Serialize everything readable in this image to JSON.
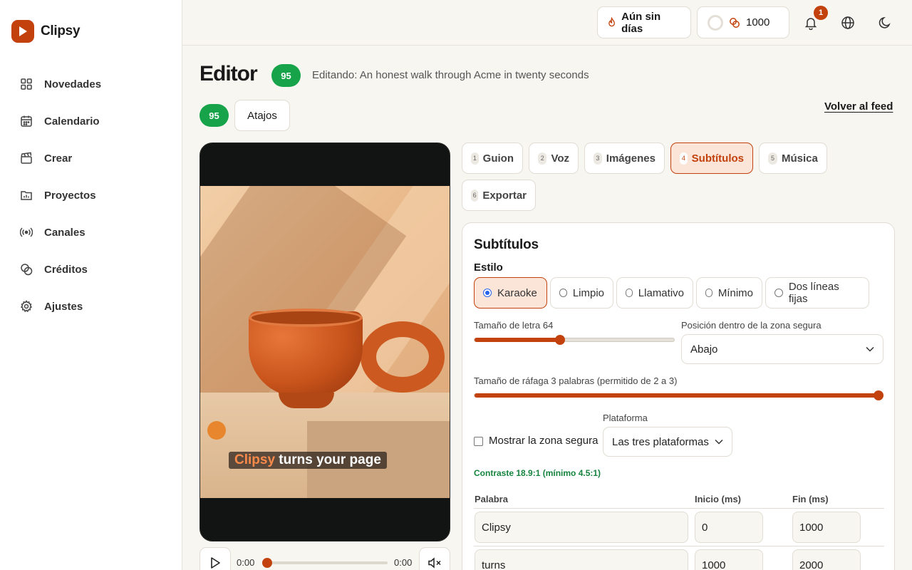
{
  "brand": {
    "name": "Clipsy"
  },
  "nav": [
    {
      "label": "Novedades"
    },
    {
      "label": "Calendario"
    },
    {
      "label": "Crear"
    },
    {
      "label": "Proyectos"
    },
    {
      "label": "Canales"
    },
    {
      "label": "Créditos"
    },
    {
      "label": "Ajustes"
    }
  ],
  "header": {
    "streak": "Aún sin días",
    "credits": "1000",
    "notifications_count": "1"
  },
  "page": {
    "title": "Editor",
    "score": "95",
    "editing": "Editando: An honest walk through Acme in twenty seconds",
    "score2": "95",
    "shortcuts": "Atajos",
    "back": "Volver al feed"
  },
  "video": {
    "caption_highlight": "Clipsy",
    "caption_rest": " turns your page",
    "time_current": "0:00",
    "time_total": "0:00",
    "progress": 0
  },
  "tabs": [
    {
      "num": "1",
      "label": "Guion"
    },
    {
      "num": "2",
      "label": "Voz"
    },
    {
      "num": "3",
      "label": "Imágenes"
    },
    {
      "num": "4",
      "label": "Subtítulos",
      "active": true
    },
    {
      "num": "5",
      "label": "Música"
    },
    {
      "num": "6",
      "label": "Exportar"
    }
  ],
  "panel": {
    "title": "Subtítulos",
    "style_label": "Estilo",
    "styles": [
      {
        "label": "Karaoke",
        "selected": true
      },
      {
        "label": "Limpio"
      },
      {
        "label": "Llamativo"
      },
      {
        "label": "Mínimo"
      },
      {
        "label": "Dos líneas fijas"
      }
    ],
    "font_size_label": "Tamaño de letra 64",
    "font_size_value": 64,
    "font_size_fraction": 0.43,
    "position_label": "Posición dentro de la zona segura",
    "position_value": "Abajo",
    "burst_label": "Tamaño de ráfaga 3 palabras (permitido de 2 a 3)",
    "burst_fraction": 1.0,
    "platform_label": "Plataforma",
    "platform_value": "Las tres plataformas",
    "safe_zone_label": "Mostrar la zona segura",
    "safe_zone_checked": false,
    "contrast": "Contraste 18.9:1 (mínimo 4.5:1)",
    "table_headers": {
      "word": "Palabra",
      "start": "Inicio (ms)",
      "end": "Fin (ms)"
    },
    "rows": [
      {
        "word": "Clipsy",
        "start": "0",
        "end": "1000"
      },
      {
        "word": "turns",
        "start": "1000",
        "end": "2000"
      }
    ]
  },
  "colors": {
    "accent": "#c2410c",
    "success": "#16a34a",
    "contrast_text": "#16843f"
  }
}
